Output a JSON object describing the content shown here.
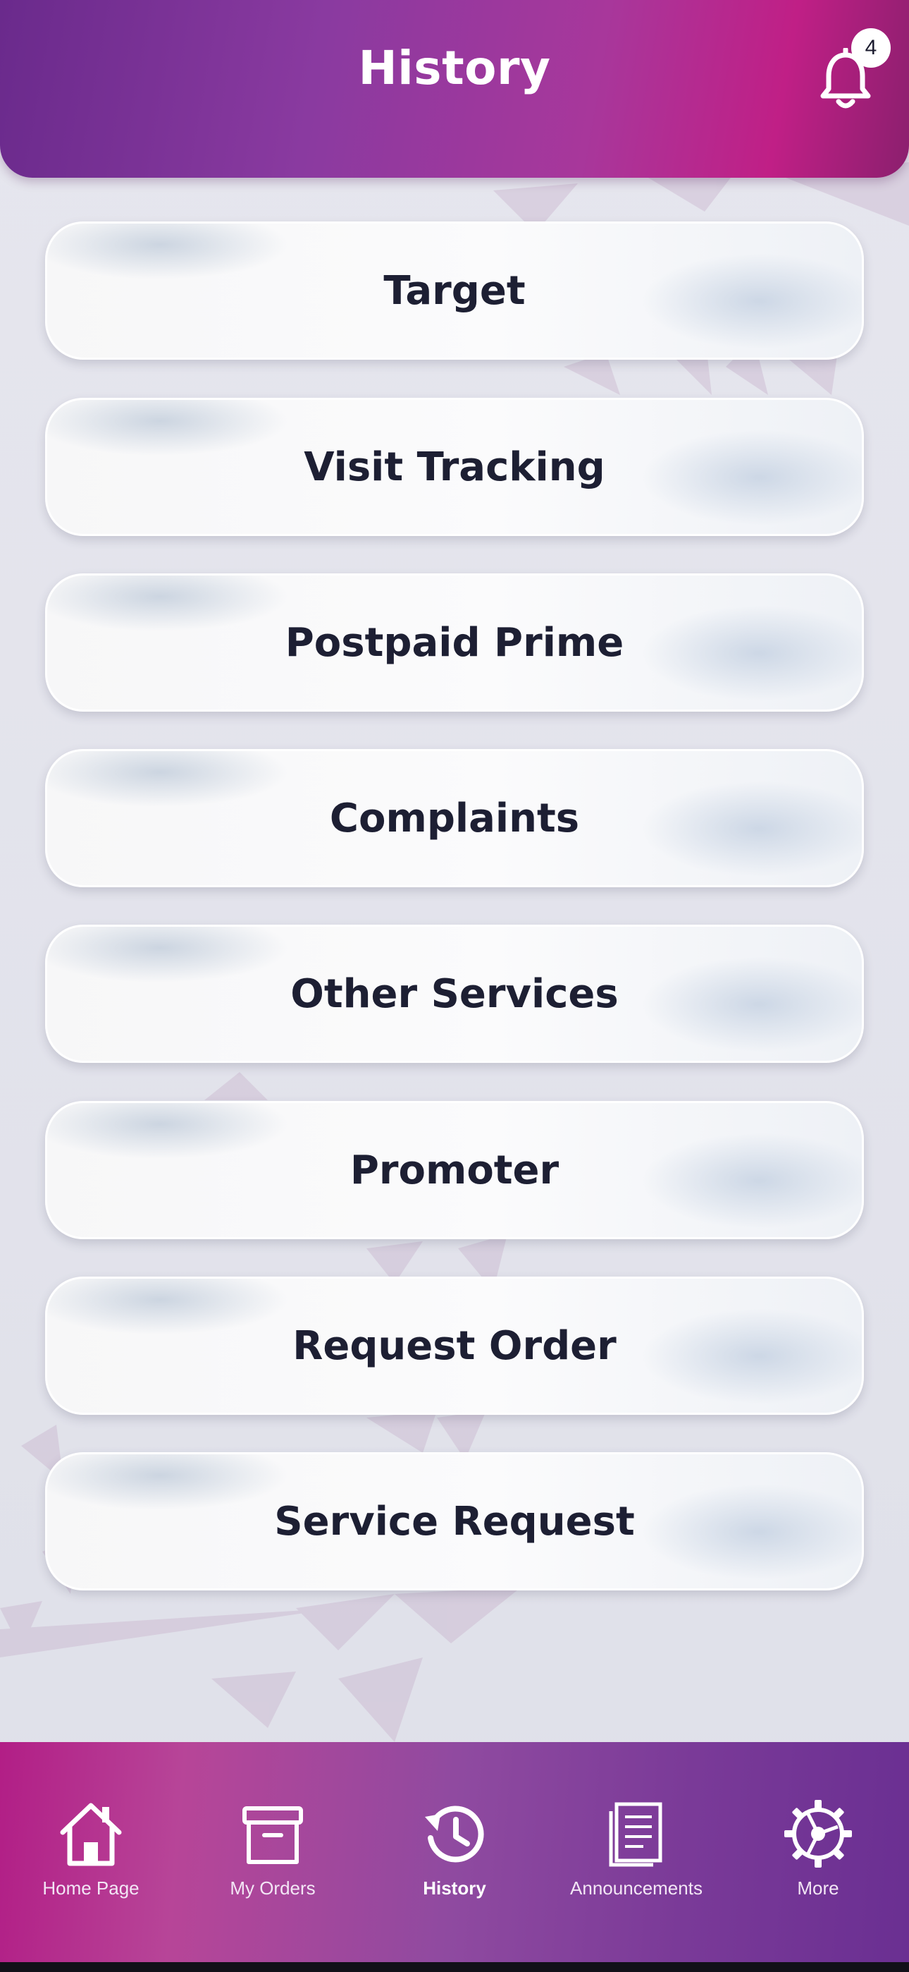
{
  "header": {
    "title": "History",
    "notification_count": "4",
    "notification_icon": "bell-icon"
  },
  "menu": {
    "items": [
      {
        "label": "Target"
      },
      {
        "label": "Visit Tracking"
      },
      {
        "label": "Postpaid Prime"
      },
      {
        "label": "Complaints"
      },
      {
        "label": "Other Services"
      },
      {
        "label": "Promoter"
      },
      {
        "label": "Request Order"
      },
      {
        "label": "Service Request"
      }
    ]
  },
  "bottom_nav": {
    "active": "History",
    "items": [
      {
        "label": "Home Page",
        "icon": "home-icon"
      },
      {
        "label": "My Orders",
        "icon": "archive-box-icon"
      },
      {
        "label": "History",
        "icon": "history-icon"
      },
      {
        "label": "Announcements",
        "icon": "document-icon"
      },
      {
        "label": "More",
        "icon": "gear-icon"
      }
    ]
  },
  "colors": {
    "header_gradient_start": "#6a2a8c",
    "header_gradient_end": "#c01f86",
    "nav_gradient_start": "#b21e86",
    "nav_gradient_end": "#6a2f92",
    "text_primary": "#1d1f33",
    "page_background": "#e4e4ec"
  }
}
